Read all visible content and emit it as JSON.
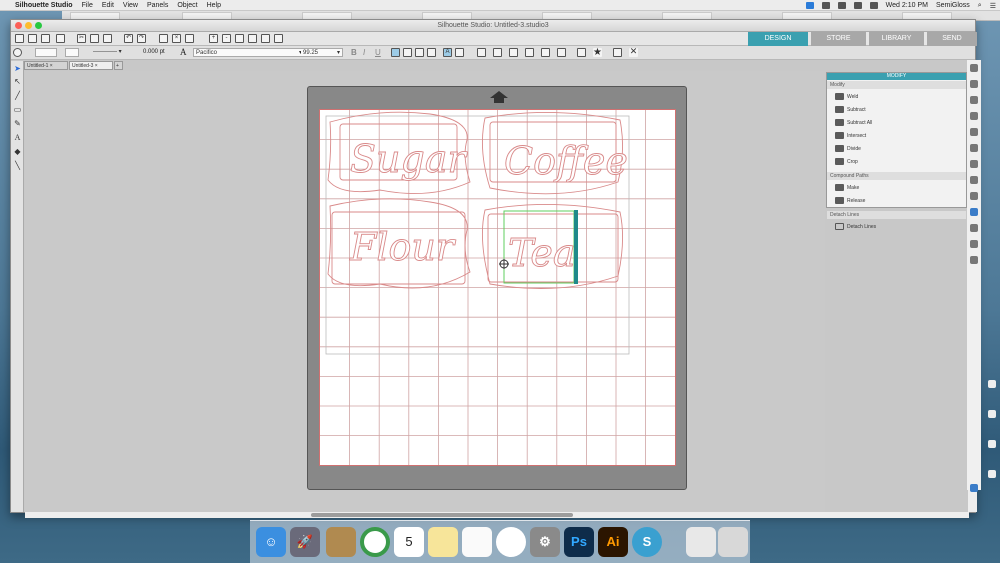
{
  "menubar": {
    "app": "Silhouette Studio",
    "items": [
      "File",
      "Edit",
      "View",
      "Panels",
      "Object",
      "Help"
    ],
    "clock": "Wed 2:10 PM",
    "user": "SemiGloss"
  },
  "window": {
    "title": "Silhouette Studio: Untitled-3.studio3"
  },
  "nav": {
    "design": "DESIGN",
    "store": "STORE",
    "library": "LIBRARY",
    "send": "SEND"
  },
  "props": {
    "line_width": "0.000",
    "line_unit": "pt",
    "font": "Pacifico",
    "font_size": "99.25",
    "bold": "B",
    "italic": "I",
    "underline": "U"
  },
  "doc_tabs": [
    "Untitled-1",
    "Untitled-3"
  ],
  "add_tab": "+",
  "designs": [
    "Sugar",
    "Coffee",
    "Flour",
    "Tea"
  ],
  "modify_panel": {
    "title": "MODIFY",
    "modify_label": "Modify",
    "weld": "Weld",
    "subtract": "Subtract",
    "subtract_all": "Subtract All",
    "intersect": "Intersect",
    "divide": "Divide",
    "crop": "Crop",
    "compound_label": "Compound Paths",
    "make": "Make",
    "release": "Release",
    "detach_label": "Detach Lines",
    "detach": "Detach Lines"
  },
  "dock": {
    "calendar_day": "5",
    "ps": "Ps",
    "ai": "Ai"
  },
  "colors": {
    "accent": "#3aa0b0",
    "cut_line": "#d48080",
    "selection": "#5fcf5f",
    "selection_bar": "#1f8a8a"
  }
}
